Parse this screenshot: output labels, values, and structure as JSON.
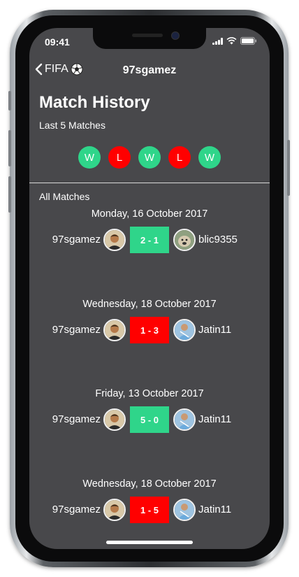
{
  "status_bar": {
    "time": "09:41"
  },
  "nav": {
    "back_label": "FIFA",
    "title": "97sgamez"
  },
  "header": {
    "title": "Match History",
    "subtitle": "Last 5 Matches"
  },
  "form": [
    "W",
    "L",
    "W",
    "L",
    "W"
  ],
  "colors": {
    "win": "#2fd58a",
    "loss": "#ff0000",
    "screen_bg": "#48484b"
  },
  "all_matches_label": "All Matches",
  "matches": [
    {
      "date": "Monday, 16 October 2017",
      "player": "97sgamez",
      "score": "2 - 1",
      "result": "win",
      "opponent": "blic9355"
    },
    {
      "date": "Wednesday, 18 October 2017",
      "player": "97sgamez",
      "score": "1 - 3",
      "result": "loss",
      "opponent": "Jatin11"
    },
    {
      "date": "Friday, 13 October 2017",
      "player": "97sgamez",
      "score": "5 - 0",
      "result": "win",
      "opponent": "Jatin11"
    },
    {
      "date": "Wednesday, 18 October 2017",
      "player": "97sgamez",
      "score": "1 - 5",
      "result": "loss",
      "opponent": "Jatin11"
    }
  ]
}
